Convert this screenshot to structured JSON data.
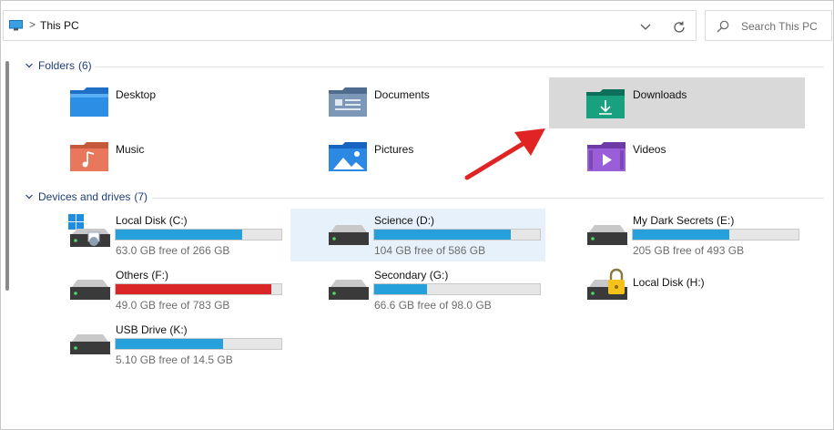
{
  "address": {
    "location": "This PC",
    "separator": ">"
  },
  "search": {
    "placeholder": "Search This PC"
  },
  "groups": {
    "folders": {
      "label": "Folders",
      "count": "(6)"
    },
    "drives": {
      "label": "Devices and drives",
      "count": "(7)"
    }
  },
  "folders": [
    {
      "name": "Desktop",
      "icon": "desktop-folder-icon"
    },
    {
      "name": "Documents",
      "icon": "documents-folder-icon"
    },
    {
      "name": "Downloads",
      "icon": "downloads-folder-icon",
      "selected": true
    },
    {
      "name": "Music",
      "icon": "music-folder-icon"
    },
    {
      "name": "Pictures",
      "icon": "pictures-folder-icon"
    },
    {
      "name": "Videos",
      "icon": "videos-folder-icon"
    }
  ],
  "drives": [
    {
      "name": "Local Disk (C:)",
      "free": "63.0 GB free of 266 GB",
      "used_fraction": 0.763,
      "bar_color": "#26a0da",
      "icon": "system-drive-icon"
    },
    {
      "name": "Science (D:)",
      "free": "104 GB free of 586 GB",
      "used_fraction": 0.823,
      "bar_color": "#26a0da",
      "icon": "hard-drive-icon",
      "hovered": true
    },
    {
      "name": "My Dark Secrets (E:)",
      "free": "205 GB free of 493 GB",
      "used_fraction": 0.584,
      "bar_color": "#26a0da",
      "icon": "hard-drive-icon"
    },
    {
      "name": "Others (F:)",
      "free": "49.0 GB free of 783 GB",
      "used_fraction": 0.937,
      "bar_color": "#da2626",
      "icon": "hard-drive-icon"
    },
    {
      "name": "Secondary (G:)",
      "free": "66.6 GB free of 98.0 GB",
      "used_fraction": 0.32,
      "bar_color": "#26a0da",
      "icon": "hard-drive-icon"
    },
    {
      "name": "Local Disk (H:)",
      "free": "",
      "used_fraction": null,
      "bar_color": "",
      "icon": "locked-drive-icon"
    },
    {
      "name": "USB Drive (K:)",
      "free": "5.10 GB free of 14.5 GB",
      "used_fraction": 0.648,
      "bar_color": "#26a0da",
      "icon": "hard-drive-icon"
    }
  ],
  "colors": {
    "accent": "#26a0da",
    "warning": "#da2626",
    "group_text": "#1f3d7a",
    "selection": "#d9d9d9",
    "hover": "#e6f1fb",
    "annotation_arrow": "#e02424"
  }
}
